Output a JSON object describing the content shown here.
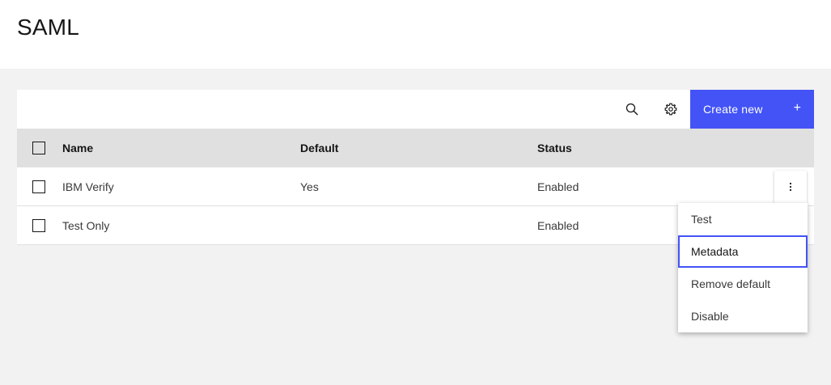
{
  "page": {
    "title": "SAML"
  },
  "toolbar": {
    "search_icon": "search-icon",
    "settings_icon": "gear-icon",
    "create_label": "Create new",
    "create_icon": "+"
  },
  "table": {
    "columns": [
      "Name",
      "Default",
      "Status"
    ],
    "rows": [
      {
        "name": "IBM Verify",
        "default": "Yes",
        "status": "Enabled"
      },
      {
        "name": "Test Only",
        "default": "",
        "status": "Enabled"
      }
    ]
  },
  "overflow_menu": {
    "icon": "overflow-menu-vertical-icon",
    "items": [
      {
        "label": "Test"
      },
      {
        "label": "Metadata",
        "focused": true
      },
      {
        "label": "Remove default"
      },
      {
        "label": "Disable"
      }
    ]
  },
  "colors": {
    "primary": "#4353f6",
    "background": "#f2f2f2",
    "header_row": "#e0e0e0"
  }
}
